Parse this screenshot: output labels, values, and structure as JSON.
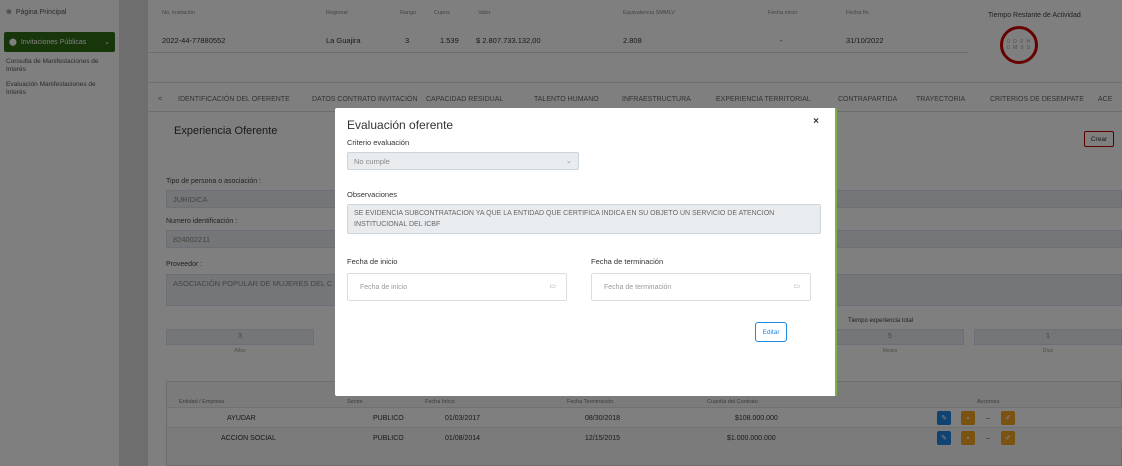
{
  "sidebar": {
    "home": "Página Principal",
    "active": "Invitaciones Públicas",
    "items": [
      "Consulta de Manifestaciones de Interés",
      "Evaluación Manifestaciones de Interés"
    ]
  },
  "top": {
    "headers": [
      "No. invitación",
      "Regional",
      "Rango",
      "Cupos",
      "Valor",
      "Equivalencia SMMLV",
      "Fecha inicio",
      "Fecha fin"
    ],
    "values": [
      "2022-44-77880552",
      "La Guajira",
      "3",
      "1.539",
      "$ 2.807.733.132,00",
      "2.808",
      "-",
      "31/10/2022"
    ],
    "timer_title": "Tiempo Restante de Actividad",
    "timer_l1": "0 D 0 H",
    "timer_l2": "0 M 0 S"
  },
  "tabs": [
    "<",
    "IDENTIFICACIÓN DEL OFERENTE",
    "DATOS CONTRATO INVITACIÓN",
    "CAPACIDAD RESIDUAL",
    "TALENTO HUMANO",
    "INFRAESTRUCTURA",
    "EXPERIENCIA TERRITORIAL",
    "CONTRAPARTIDA",
    "TRAYECTORIA",
    "CRITERIOS DE DESEMPATE",
    "ACE"
  ],
  "section": {
    "title": "Experiencia Oferente",
    "crear": "Crear"
  },
  "form": {
    "tipo_label": "Tipo de persona o asociación :",
    "tipo_value": "JURIDICA",
    "num_label": "Numero identificación :",
    "num_value": "824002211",
    "prov_label": "Proveedor :",
    "prov_value": "ASOCIACIÓN POPULAR DE MUJERES DEL C"
  },
  "counts": {
    "left_value": "3",
    "left_unit": "Años",
    "total_label": "Tiempo experiencia total",
    "v2": "5",
    "u2": "Meses",
    "v3": "1",
    "u3": "Días"
  },
  "table": {
    "headers": [
      "Entidad / Empresa",
      "Sector",
      "Fecha Inicio",
      "Fecha Terminación",
      "Cuantía del Contrato",
      "Acciones"
    ],
    "rows": [
      [
        "AYUDAR",
        "PUBLICO",
        "01/03/2017",
        "08/30/2018",
        "$108.000.000"
      ],
      [
        "ACCION SOCIAL",
        "PUBLICO",
        "01/08/2014",
        "12/15/2015",
        "$1.000.000.000"
      ]
    ]
  },
  "modal": {
    "title": "Evaluación oferente",
    "close": "×",
    "criterio_label": "Criterio evaluación",
    "criterio_value": "No cumple",
    "obs_label": "Observaciones",
    "obs_value": "SE EVIDENCIA SUBCONTRATACION YA QUE LA ENTIDAD QUE CERTIFICA INDICA EN SU OBJETO UN SERVICIO DE ATENCION INSTITUCIONAL DEL ICBF",
    "inicio_label": "Fecha de inicio",
    "inicio_placeholder": "Fecha de inicio",
    "fin_label": "Fecha de terminación",
    "fin_placeholder": "Fecha de terminación",
    "edit": "Editar"
  },
  "colors": {
    "sidebar_active": "#2e6d14",
    "timer_ring": "#cc0000",
    "accent": "#1e88e5",
    "modal_edge": "#7cb342"
  }
}
